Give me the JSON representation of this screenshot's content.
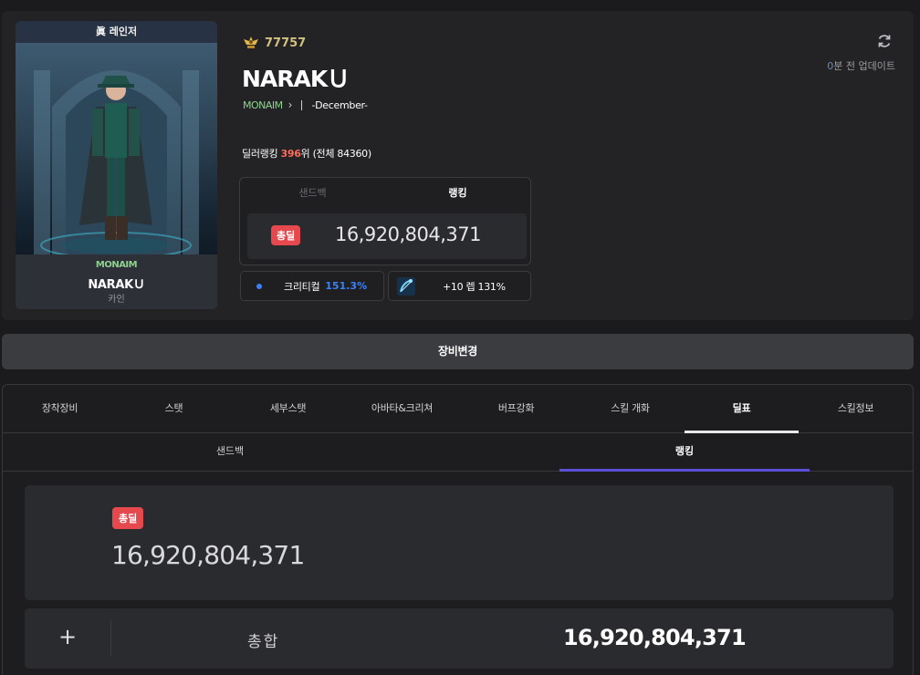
{
  "character": {
    "card_title": "眞 레인저",
    "guild": "MONAIM",
    "name": "NARAKＵ",
    "job": "카인",
    "fame_value": "77757",
    "display_name": "NARAKＵ",
    "adventure_name": "-December-"
  },
  "update": {
    "minutes": "0",
    "suffix": "분 전 업데이트"
  },
  "ranking": {
    "prefix": "딜러랭킹",
    "rank": "396",
    "suffix": "위 (전체 84360)"
  },
  "score_box": {
    "tabs": [
      "샌드백",
      "랭킹"
    ],
    "badge": "총딜",
    "value": "16,920,804,371"
  },
  "crit": {
    "label": "크리티컬",
    "value": "151.3%"
  },
  "weapon": {
    "label": "+10 렙 131%"
  },
  "equip_change": "장비변경",
  "main_tabs": [
    "장착장비",
    "스탯",
    "세부스탯",
    "아바타&크리쳐",
    "버프강화",
    "스킬 개화",
    "딜표",
    "스킬정보"
  ],
  "sub_tabs": [
    "샌드백",
    "랭킹"
  ],
  "total": {
    "badge": "총딜",
    "value": "16,920,804,371"
  },
  "summary": {
    "expand": "+",
    "label": "총합",
    "value": "16,920,804,371"
  },
  "colors": {
    "accent_red": "#e5484d",
    "guild_green": "#8fd08f",
    "crit_blue": "#3b82f6",
    "tab_underline": "#5a4fd6"
  }
}
